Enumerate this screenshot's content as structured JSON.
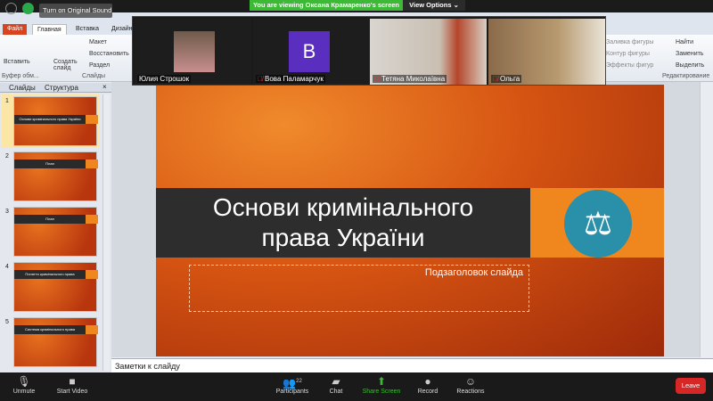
{
  "zoom": {
    "banner": "You are viewing Оксана Крамаренко's screen",
    "view_options": "View Options ⌄",
    "original_sound": "Turn on Original Sound"
  },
  "ppt": {
    "tabs": [
      "Файл",
      "Главная",
      "Вставка",
      "Дизайн"
    ],
    "ribbon": {
      "paste": "Вставить",
      "new_slide": "Создать слайд",
      "layout": "Макет",
      "reset": "Восстановить",
      "section": "Раздел",
      "clipboard_group": "Буфер обм...",
      "slides_group": "Слайды",
      "shape_fill": "Заливка фигуры",
      "shape_outline": "Контур фигуры",
      "shape_effects": "Эффекты фигур",
      "find": "Найти",
      "replace": "Заменить",
      "select": "Выделить",
      "editing_group": "Редактирование"
    },
    "pane_tabs": [
      "Слайды",
      "Структура"
    ],
    "thumbnails": [
      {
        "num": "1",
        "title": "Основи кримінального права України"
      },
      {
        "num": "2",
        "title": "План"
      },
      {
        "num": "3",
        "title": "План"
      },
      {
        "num": "4",
        "title": "Поняття кримінального права"
      },
      {
        "num": "5",
        "title": "Система кримінального права"
      }
    ],
    "slide": {
      "title_line1": "Основи кримінального",
      "title_line2": "права України",
      "subtitle": "Подзаголовок слайда",
      "icon": "⚖"
    },
    "notes": "Заметки к слайду"
  },
  "participants": [
    {
      "name": "Юлия Строшок",
      "muted": false
    },
    {
      "name": "Вова Паламарчук",
      "muted": true,
      "initial": "B"
    },
    {
      "name": "Тетяна Миколаївна",
      "muted": true
    },
    {
      "name": "Ольга",
      "muted": true
    }
  ],
  "toolbar": {
    "unmute": "Unmute",
    "start_video": "Start Video",
    "participants": "Participants",
    "participant_count": "22",
    "chat": "Chat",
    "share": "Share Screen",
    "record": "Record",
    "reactions": "Reactions",
    "leave": "Leave"
  },
  "colors": {
    "share_green": "#3cb935",
    "leave_red": "#d72626",
    "slide_orange": "#f0861e",
    "icon_teal": "#2a8fa8"
  }
}
